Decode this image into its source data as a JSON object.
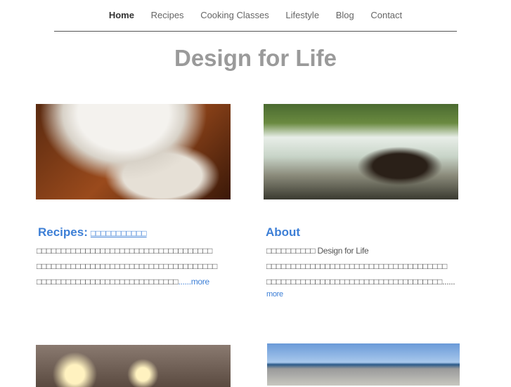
{
  "nav": {
    "items": [
      "Home",
      "Recipes",
      "Cooking Classes",
      "Lifestyle",
      "Blog",
      "Contact"
    ]
  },
  "site_title": "Design for Life",
  "recipes": {
    "heading": "Recipes:",
    "subtitle": "□□□□□□□□□□□",
    "lines": [
      "□□□□□□□□□□□□□□□□□□□□□□□□□□□□□□□□□□□□",
      "□□□□□□□□□□□□□□□□□□□□□□□□□□□□□□□□□□□□□",
      "□□□□□□□□□□□□□□□□□□□□□□□□□□□□□"
    ],
    "more": "......more"
  },
  "about": {
    "heading": "About",
    "lines": [
      "□□□□□□□□□□ Design for Life",
      "□□□□□□□□□□□□□□□□□□□□□□□□□□□□□□□□□□□□□",
      "□□□□□□□□□□□□□□□□□□□□□□□□□□□□□□□□□□□□......"
    ],
    "more": "more"
  }
}
